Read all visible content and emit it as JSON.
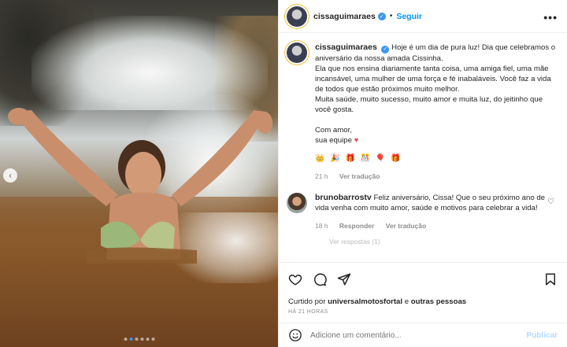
{
  "post": {
    "username": "cissaguimaraes",
    "follow_label": "Seguir",
    "more_label": "•••",
    "verified_mark": "✓"
  },
  "caption": {
    "username": "cissaguimaraes",
    "text_1": "Hoje é um dia de pura luz! Dia que celebramos o aniversário da nossa amada Cissinha.",
    "text_2": "Ela que nos ensina diariamente tanta coisa, uma amiga fiel, uma mãe incansável, uma mulher de uma força e fé inabaláveis. Você faz a vida de todos que estão próximos muito melhor.",
    "text_3": "Muita saúde, muito sucesso, muito amor e muita luz, do jeitinho que você gosta.",
    "text_4": "Com amor,",
    "text_5": "sua equipe",
    "heart": "♥",
    "emojis": "👑 🎉 🎁 🎊 🎈 🎁",
    "time": "21 h",
    "translate": "Ver tradução"
  },
  "comment": {
    "username": "brunobarrostv",
    "text": "Feliz aniversário, Cissa! Que o seu próximo ano de vida venha com muito amor, saúde e motivos para celebrar a vida!",
    "time": "18 h",
    "reply": "Responder",
    "translate": "Ver tradução",
    "view_replies": "Ver respostas (1)",
    "heart": "♡"
  },
  "actions": {
    "liked_prefix": "Curtido por",
    "liked_user": "universalmotosfortal",
    "liked_and": "e",
    "liked_others": "outras pessoas",
    "time_ago": "HÁ 21 HORAS"
  },
  "add_comment": {
    "placeholder": "Adicione um comentário...",
    "publish": "Publicar"
  },
  "carousel": {
    "prev_icon": "‹",
    "slide_count": 6,
    "active_slide": 1
  },
  "colors": {
    "link_blue": "#0095f6",
    "verified_blue": "#3897f0",
    "heart_red": "#ed4956",
    "muted": "#8e8e8e"
  }
}
